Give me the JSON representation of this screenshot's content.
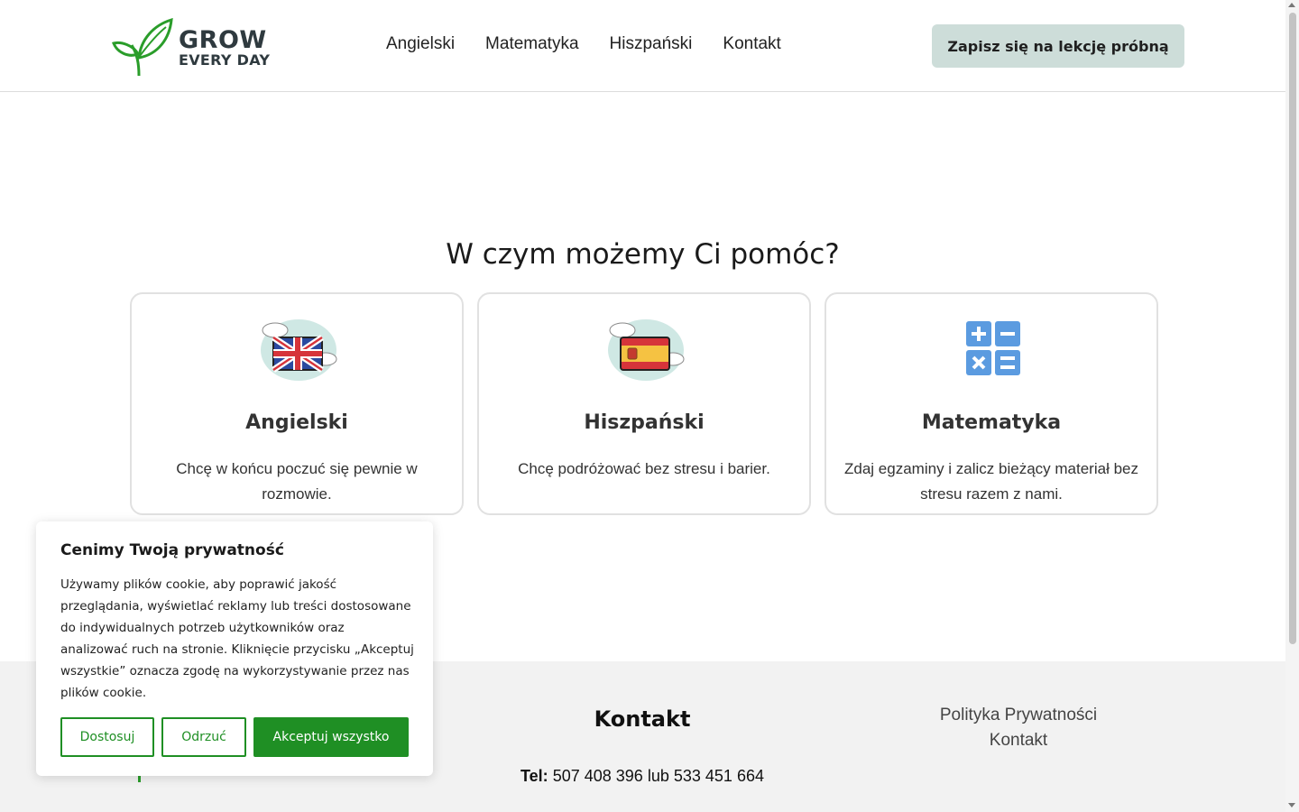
{
  "header": {
    "logo": {
      "line1": "GROW",
      "line2": "EVERY DAY",
      "color": "#2a9d2a"
    },
    "nav": [
      {
        "label": "Angielski"
      },
      {
        "label": "Matematyka"
      },
      {
        "label": "Hiszpański"
      },
      {
        "label": "Kontakt"
      }
    ],
    "cta_label": "Zapisz się na lekcję próbną"
  },
  "main": {
    "title": "W czym możemy Ci pomóc?",
    "cards": [
      {
        "icon": "uk-flag-icon",
        "title": "Angielski",
        "text": "Chcę w końcu poczuć się pewnie w rozmowie."
      },
      {
        "icon": "spain-flag-icon",
        "title": "Hiszpański",
        "text": "Chcę podróżować bez stresu i barier."
      },
      {
        "icon": "calculator-icon",
        "title": "Matematyka",
        "text": "Zdaj egzaminy i zalicz bieżący materiał bez stresu razem z nami."
      }
    ]
  },
  "footer": {
    "heading": "Kontakt",
    "phone_label": "Tel:",
    "phone_1": "507 408 396",
    "phone_sep": "lub",
    "phone_2": "533 451 664",
    "links": [
      {
        "label": "Polityka Prywatności"
      },
      {
        "label": "Kontakt"
      }
    ]
  },
  "cookie": {
    "title": "Cenimy Twoją prywatność",
    "text": "Używamy plików cookie, aby poprawić jakość przeglądania, wyświetlać reklamy lub treści dostosowane do indywidualnych potrzeb użytkowników oraz analizować ruch na stronie. Kliknięcie przycisku „Akceptuj wszystkie” oznacza zgodę na wykorzystywanie przez nas plików cookie.",
    "btn_customize": "Dostosuj",
    "btn_reject": "Odrzuć",
    "btn_accept": "Akceptuj wszystko",
    "accent": "#1f8f24"
  }
}
